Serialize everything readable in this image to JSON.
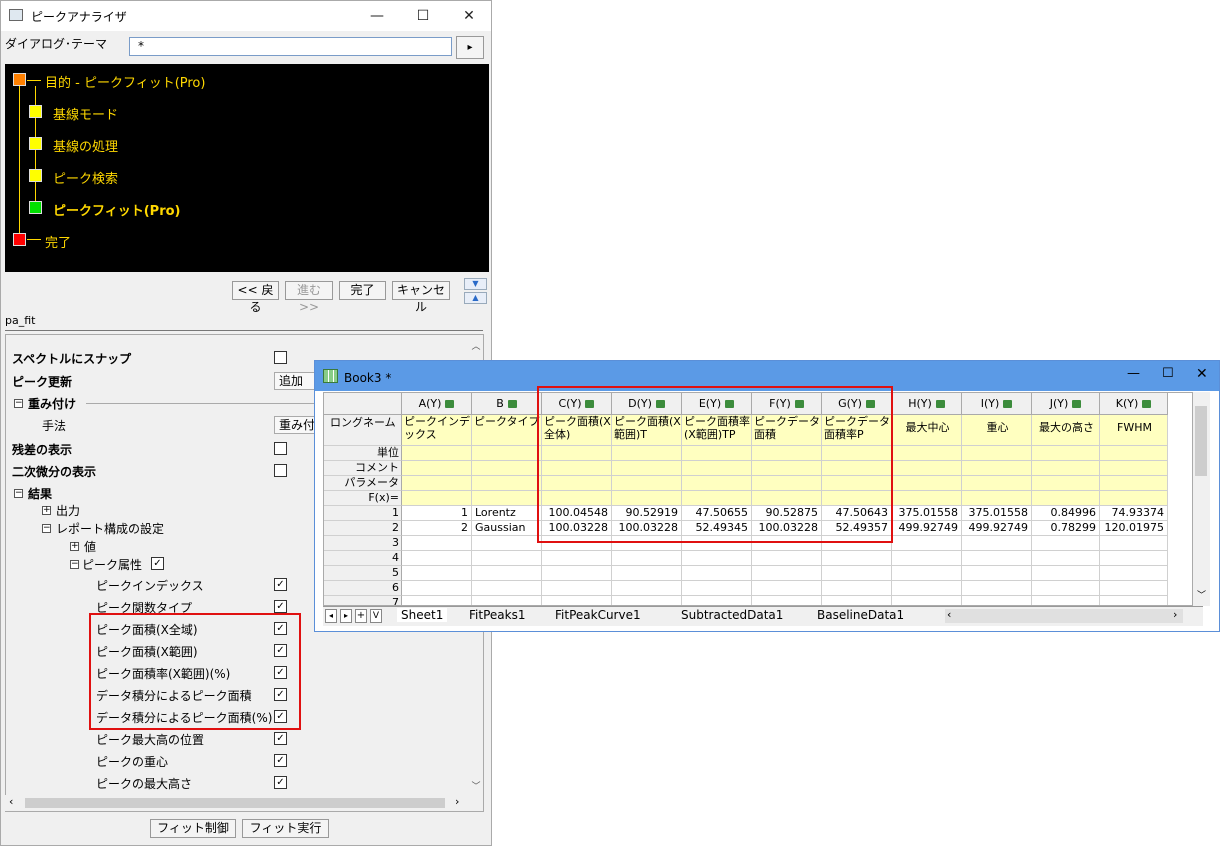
{
  "dialog": {
    "title": "ピークアナライザ",
    "win_min": "—",
    "win_max": "☐",
    "win_close": "✕",
    "theme_label": "ダイアログ･テーマ",
    "theme_value": "*",
    "theme_arrow": "▸",
    "tree": [
      {
        "label": "目的 - ピークフィット(Pro)",
        "color": "#ff8000"
      },
      {
        "label": "基線モード",
        "color": "#ffff00"
      },
      {
        "label": "基線の処理",
        "color": "#ffff00"
      },
      {
        "label": "ピーク検索",
        "color": "#ffff00"
      },
      {
        "label": "ピークフィット(Pro)",
        "color": "#00e000"
      },
      {
        "label": "完了",
        "color": "#ff0000"
      }
    ],
    "nav": {
      "back": "<< 戻る",
      "next": "進む >>",
      "finish": "完了",
      "cancel": "キャンセル"
    },
    "function_name": "pa_fit",
    "props": {
      "snap": "スペクトルにスナップ",
      "update": "ピーク更新",
      "update_btn": "追加",
      "weight": "重み付け",
      "method": "手法",
      "method_value": "重み付け",
      "residual": "残差の表示",
      "second_deriv": "二次微分の表示",
      "result": "結果",
      "output": "出力",
      "report": "レポート構成の設定",
      "value": "値",
      "peak_attr": "ピーク属性",
      "attrs": [
        {
          "label": "ピークインデックス",
          "checked": true
        },
        {
          "label": "ピーク関数タイプ",
          "checked": true
        },
        {
          "label": "ピーク面積(X全域)",
          "checked": true
        },
        {
          "label": "ピーク面積(X範囲)",
          "checked": true
        },
        {
          "label": "ピーク面積率(X範囲)(%)",
          "checked": true
        },
        {
          "label": "データ積分によるピーク面積",
          "checked": true
        },
        {
          "label": "データ積分によるピーク面積(%)",
          "checked": true
        },
        {
          "label": "ピーク最大高の位置",
          "checked": true
        },
        {
          "label": "ピークの重心",
          "checked": true
        },
        {
          "label": "ピークの最大高さ",
          "checked": true
        }
      ]
    },
    "buttons": {
      "fit_control": "フィット制御",
      "fit_run": "フィット実行"
    }
  },
  "book": {
    "title": "Book3 *",
    "win_min": "—",
    "win_max": "☐",
    "win_close": "✕",
    "columns": [
      {
        "name": "A(Y)",
        "long": "ピークインデックス"
      },
      {
        "name": "B",
        "long": "ピークタイプ"
      },
      {
        "name": "C(Y)",
        "long": "ピーク面積(X全体)"
      },
      {
        "name": "D(Y)",
        "long": "ピーク面積(X範囲)T"
      },
      {
        "name": "E(Y)",
        "long": "ピーク面積率(X範囲)TP"
      },
      {
        "name": "F(Y)",
        "long": "ピークデータ面積"
      },
      {
        "name": "G(Y)",
        "long": "ピークデータ面積率P"
      },
      {
        "name": "H(Y)",
        "long": "最大中心"
      },
      {
        "name": "I(Y)",
        "long": "重心"
      },
      {
        "name": "J(Y)",
        "long": "最大の高さ"
      },
      {
        "name": "K(Y)",
        "long": "FWHM"
      }
    ],
    "row_labels": [
      "ロングネーム",
      "単位",
      "コメント",
      "パラメータ",
      "F(x)="
    ],
    "rows": [
      [
        "1",
        "Lorentz",
        "100.04548",
        "90.52919",
        "47.50655",
        "90.52875",
        "47.50643",
        "375.01558",
        "375.01558",
        "0.84996",
        "74.93374"
      ],
      [
        "2",
        "Gaussian",
        "100.03228",
        "100.03228",
        "52.49345",
        "100.03228",
        "52.49357",
        "499.92749",
        "499.92749",
        "0.78299",
        "120.01975"
      ]
    ],
    "row_numbers": [
      "1",
      "2",
      "3",
      "4",
      "5",
      "6",
      "7"
    ],
    "tab_nav": [
      "◂",
      "▸",
      "+",
      "V"
    ],
    "tabs": [
      "Sheet1",
      "FitPeaks1",
      "FitPeakCurve1",
      "SubtractedData1",
      "BaselineData1"
    ]
  }
}
